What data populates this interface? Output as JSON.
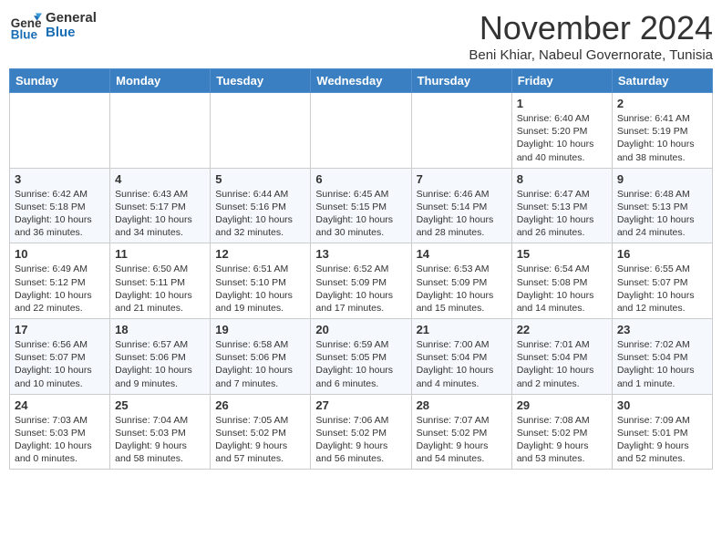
{
  "header": {
    "logo_line1": "General",
    "logo_line2": "Blue",
    "month": "November 2024",
    "location": "Beni Khiar, Nabeul Governorate, Tunisia"
  },
  "days_of_week": [
    "Sunday",
    "Monday",
    "Tuesday",
    "Wednesday",
    "Thursday",
    "Friday",
    "Saturday"
  ],
  "weeks": [
    [
      {
        "day": "",
        "info": ""
      },
      {
        "day": "",
        "info": ""
      },
      {
        "day": "",
        "info": ""
      },
      {
        "day": "",
        "info": ""
      },
      {
        "day": "",
        "info": ""
      },
      {
        "day": "1",
        "info": "Sunrise: 6:40 AM\nSunset: 5:20 PM\nDaylight: 10 hours and 40 minutes."
      },
      {
        "day": "2",
        "info": "Sunrise: 6:41 AM\nSunset: 5:19 PM\nDaylight: 10 hours and 38 minutes."
      }
    ],
    [
      {
        "day": "3",
        "info": "Sunrise: 6:42 AM\nSunset: 5:18 PM\nDaylight: 10 hours and 36 minutes."
      },
      {
        "day": "4",
        "info": "Sunrise: 6:43 AM\nSunset: 5:17 PM\nDaylight: 10 hours and 34 minutes."
      },
      {
        "day": "5",
        "info": "Sunrise: 6:44 AM\nSunset: 5:16 PM\nDaylight: 10 hours and 32 minutes."
      },
      {
        "day": "6",
        "info": "Sunrise: 6:45 AM\nSunset: 5:15 PM\nDaylight: 10 hours and 30 minutes."
      },
      {
        "day": "7",
        "info": "Sunrise: 6:46 AM\nSunset: 5:14 PM\nDaylight: 10 hours and 28 minutes."
      },
      {
        "day": "8",
        "info": "Sunrise: 6:47 AM\nSunset: 5:13 PM\nDaylight: 10 hours and 26 minutes."
      },
      {
        "day": "9",
        "info": "Sunrise: 6:48 AM\nSunset: 5:13 PM\nDaylight: 10 hours and 24 minutes."
      }
    ],
    [
      {
        "day": "10",
        "info": "Sunrise: 6:49 AM\nSunset: 5:12 PM\nDaylight: 10 hours and 22 minutes."
      },
      {
        "day": "11",
        "info": "Sunrise: 6:50 AM\nSunset: 5:11 PM\nDaylight: 10 hours and 21 minutes."
      },
      {
        "day": "12",
        "info": "Sunrise: 6:51 AM\nSunset: 5:10 PM\nDaylight: 10 hours and 19 minutes."
      },
      {
        "day": "13",
        "info": "Sunrise: 6:52 AM\nSunset: 5:09 PM\nDaylight: 10 hours and 17 minutes."
      },
      {
        "day": "14",
        "info": "Sunrise: 6:53 AM\nSunset: 5:09 PM\nDaylight: 10 hours and 15 minutes."
      },
      {
        "day": "15",
        "info": "Sunrise: 6:54 AM\nSunset: 5:08 PM\nDaylight: 10 hours and 14 minutes."
      },
      {
        "day": "16",
        "info": "Sunrise: 6:55 AM\nSunset: 5:07 PM\nDaylight: 10 hours and 12 minutes."
      }
    ],
    [
      {
        "day": "17",
        "info": "Sunrise: 6:56 AM\nSunset: 5:07 PM\nDaylight: 10 hours and 10 minutes."
      },
      {
        "day": "18",
        "info": "Sunrise: 6:57 AM\nSunset: 5:06 PM\nDaylight: 10 hours and 9 minutes."
      },
      {
        "day": "19",
        "info": "Sunrise: 6:58 AM\nSunset: 5:06 PM\nDaylight: 10 hours and 7 minutes."
      },
      {
        "day": "20",
        "info": "Sunrise: 6:59 AM\nSunset: 5:05 PM\nDaylight: 10 hours and 6 minutes."
      },
      {
        "day": "21",
        "info": "Sunrise: 7:00 AM\nSunset: 5:04 PM\nDaylight: 10 hours and 4 minutes."
      },
      {
        "day": "22",
        "info": "Sunrise: 7:01 AM\nSunset: 5:04 PM\nDaylight: 10 hours and 2 minutes."
      },
      {
        "day": "23",
        "info": "Sunrise: 7:02 AM\nSunset: 5:04 PM\nDaylight: 10 hours and 1 minute."
      }
    ],
    [
      {
        "day": "24",
        "info": "Sunrise: 7:03 AM\nSunset: 5:03 PM\nDaylight: 10 hours and 0 minutes."
      },
      {
        "day": "25",
        "info": "Sunrise: 7:04 AM\nSunset: 5:03 PM\nDaylight: 9 hours and 58 minutes."
      },
      {
        "day": "26",
        "info": "Sunrise: 7:05 AM\nSunset: 5:02 PM\nDaylight: 9 hours and 57 minutes."
      },
      {
        "day": "27",
        "info": "Sunrise: 7:06 AM\nSunset: 5:02 PM\nDaylight: 9 hours and 56 minutes."
      },
      {
        "day": "28",
        "info": "Sunrise: 7:07 AM\nSunset: 5:02 PM\nDaylight: 9 hours and 54 minutes."
      },
      {
        "day": "29",
        "info": "Sunrise: 7:08 AM\nSunset: 5:02 PM\nDaylight: 9 hours and 53 minutes."
      },
      {
        "day": "30",
        "info": "Sunrise: 7:09 AM\nSunset: 5:01 PM\nDaylight: 9 hours and 52 minutes."
      }
    ]
  ]
}
